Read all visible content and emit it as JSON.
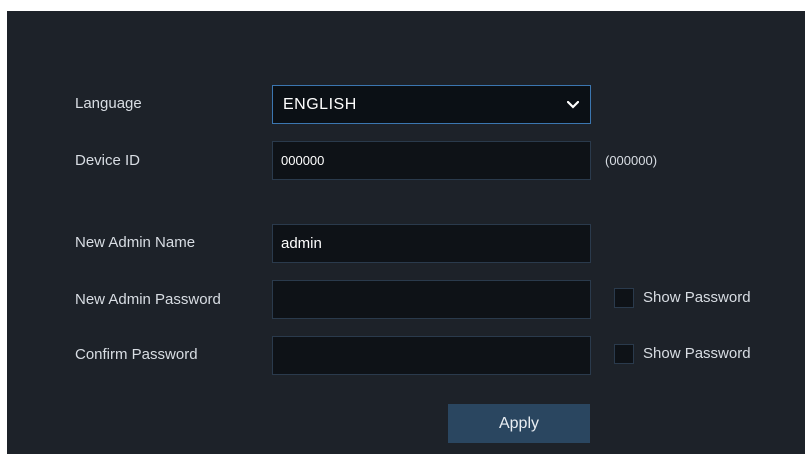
{
  "form": {
    "language": {
      "label": "Language",
      "value": "ENGLISH"
    },
    "device_id": {
      "label": "Device ID",
      "value": "000000",
      "hint": "(000000)"
    },
    "admin_name": {
      "label": "New Admin Name",
      "value": "admin"
    },
    "admin_password": {
      "label": "New Admin Password",
      "value": "",
      "show_label": "Show Password"
    },
    "confirm_password": {
      "label": "Confirm Password",
      "value": "",
      "show_label": "Show Password"
    },
    "apply_label": "Apply"
  },
  "icons": {
    "language_dropdown": "chevron-down-icon"
  },
  "colors": {
    "panel_bg": "#1d2229",
    "field_bg": "#0e1217",
    "field_border": "#2a3a4c",
    "focus_border": "#3b76b0",
    "button_bg": "#2a4660",
    "text": "#d8dde3"
  }
}
